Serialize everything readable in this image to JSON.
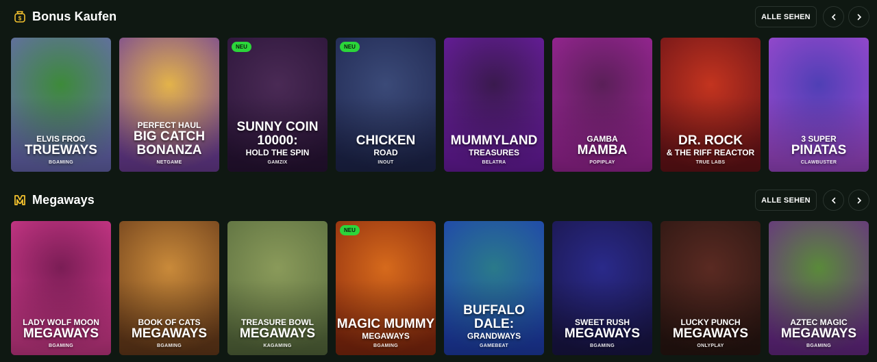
{
  "sections": [
    {
      "title": "Bonus Kaufen",
      "icon": "bag-coin-icon",
      "see_all_label": "ALLE SEHEN",
      "cards": [
        {
          "line1": "ELVIS FROG",
          "line2": "TRUEWAYS",
          "line3": "",
          "provider": "BGAMING",
          "badge": "",
          "colors": [
            "#3d8a3a",
            "#6a6ab5"
          ]
        },
        {
          "line1": "PERFECT HAUL",
          "line2": "BIG CATCH BONANZA",
          "line3": "",
          "provider": "NETGAME",
          "badge": "",
          "colors": [
            "#e3b34a",
            "#6f3f9a"
          ]
        },
        {
          "line1": "",
          "line2": "SUNNY COIN 10000:",
          "line3": "HOLD THE SPIN",
          "provider": "GAMZIX",
          "badge": "NEU",
          "colors": [
            "#4a2a55",
            "#2a1438"
          ]
        },
        {
          "line1": "",
          "line2": "CHICKEN",
          "line3": "ROAD",
          "provider": "INOUT",
          "badge": "NEU",
          "colors": [
            "#3b4a78",
            "#1f2750"
          ]
        },
        {
          "line1": "",
          "line2": "MUMMYLAND",
          "line3": "TREASURES",
          "provider": "BELATRA",
          "badge": "",
          "colors": [
            "#3a1a4e",
            "#6d1da6"
          ]
        },
        {
          "line1": "GAMBA",
          "line2": "MAMBA",
          "line3": "",
          "provider": "POPIPLAY",
          "badge": "",
          "colors": [
            "#5a1f58",
            "#a0269b"
          ]
        },
        {
          "line1": "",
          "line2": "DR. ROCK",
          "line3": "& THE RIFF REACTOR",
          "provider": "TRUE LABS",
          "badge": "",
          "colors": [
            "#c3341f",
            "#6a1318"
          ]
        },
        {
          "line1": "3 SUPER",
          "line2": "PINATAS",
          "line3": "",
          "provider": "CLAWBUSTER",
          "badge": "",
          "colors": [
            "#4f3fb5",
            "#a24ad0"
          ]
        }
      ]
    },
    {
      "title": "Megaways",
      "icon": "megaways-m-icon",
      "see_all_label": "ALLE SEHEN",
      "cards": [
        {
          "line1": "LADY WOLF MOON",
          "line2": "MEGAWAYS",
          "line3": "",
          "provider": "BGAMING",
          "badge": "",
          "colors": [
            "#7a1d55",
            "#d13a8c"
          ]
        },
        {
          "line1": "BOOK OF CATS",
          "line2": "MEGAWAYS",
          "line3": "",
          "provider": "BGAMING",
          "badge": "",
          "colors": [
            "#c98a3a",
            "#6b3d1b"
          ]
        },
        {
          "line1": "TREASURE BOWL",
          "line2": "MEGAWAYS",
          "line3": "",
          "provider": "KAGAMING",
          "badge": "",
          "colors": [
            "#8a9a5a",
            "#5a6e3f"
          ]
        },
        {
          "line1": "",
          "line2": "MAGIC MUMMY",
          "line3": "MEGAWAYS",
          "provider": "BGAMING",
          "badge": "NEU",
          "colors": [
            "#d66a1c",
            "#8a2a0e"
          ]
        },
        {
          "line1": "",
          "line2": "BUFFALO DALE:",
          "line3": "GRANDWAYS",
          "provider": "GAMEBEAT",
          "badge": "",
          "colors": [
            "#2a7a8a",
            "#1f3fb0"
          ]
        },
        {
          "line1": "SWEET RUSH",
          "line2": "MEGAWAYS",
          "line3": "",
          "provider": "BGAMING",
          "badge": "",
          "colors": [
            "#2a2a8a",
            "#1a164a"
          ]
        },
        {
          "line1": "LUCKY PUNCH",
          "line2": "MEGAWAYS",
          "line3": "",
          "provider": "ONLYPLAY",
          "badge": "",
          "colors": [
            "#5a2a22",
            "#2a1612"
          ]
        },
        {
          "line1": "AZTEC MAGIC",
          "line2": "MEGAWAYS",
          "line3": "",
          "provider": "BGAMING",
          "badge": "",
          "colors": [
            "#5a8a3a",
            "#6a2a8a"
          ]
        }
      ]
    }
  ]
}
